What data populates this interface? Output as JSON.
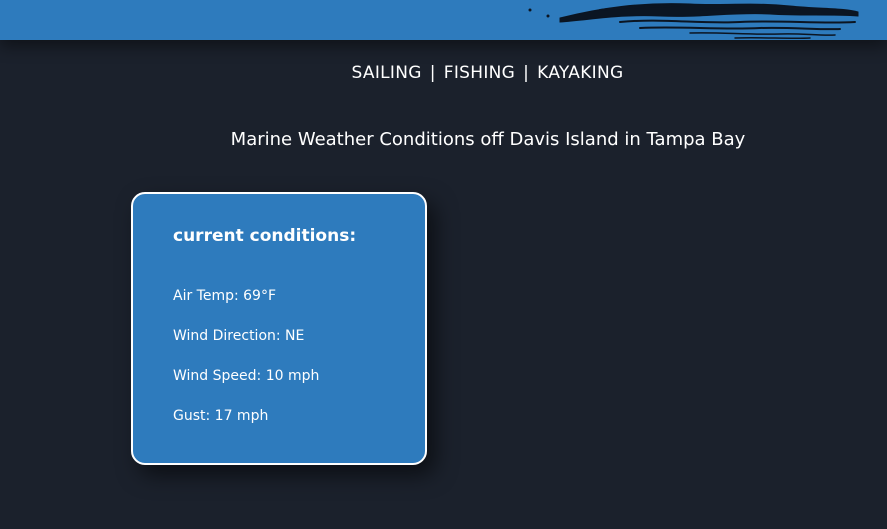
{
  "nav": {
    "items": [
      "SAILING",
      "FISHING",
      "KAYAKING"
    ],
    "separator": "|"
  },
  "headline": "Marine Weather Conditions off Davis Island in Tampa Bay",
  "conditions": {
    "title": "current conditions:",
    "air_temp": "Air Temp: 69°F",
    "wind_direction": "Wind Direction: NE",
    "wind_speed": "Wind Speed: 10 mph",
    "gust": "Gust: 17 mph"
  },
  "colors": {
    "background": "#1b212c",
    "banner": "#2e7bbd",
    "card": "#2e7bbd",
    "text": "#ffffff"
  }
}
